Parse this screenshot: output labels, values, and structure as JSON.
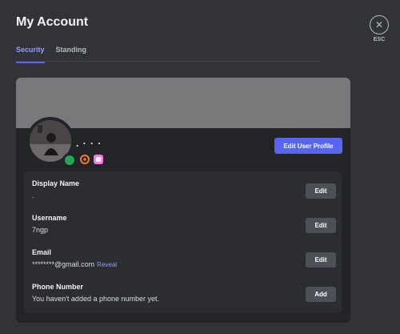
{
  "header": {
    "title": "My Account"
  },
  "tabs": [
    {
      "label": "Security",
      "active": true
    },
    {
      "label": "Standing",
      "active": false
    }
  ],
  "close": {
    "glyph": "✕",
    "label": "ESC"
  },
  "profile": {
    "display_name_preview": ". · · ·",
    "edit_button": "Edit User Profile",
    "status_color": "#23a55a",
    "banner_color": "#7b787b"
  },
  "fields": [
    {
      "label": "Display Name",
      "value": ".",
      "action": "Edit"
    },
    {
      "label": "Username",
      "value": "7ngp",
      "action": "Edit"
    },
    {
      "label": "Email",
      "value": "********@gmail.com",
      "extra": "Reveal",
      "action": "Edit"
    },
    {
      "label": "Phone Number",
      "value": "You haven't added a phone number yet.",
      "action": "Add"
    }
  ],
  "colors": {
    "accent": "#5865f2",
    "background": "#313338",
    "card": "#232428"
  }
}
